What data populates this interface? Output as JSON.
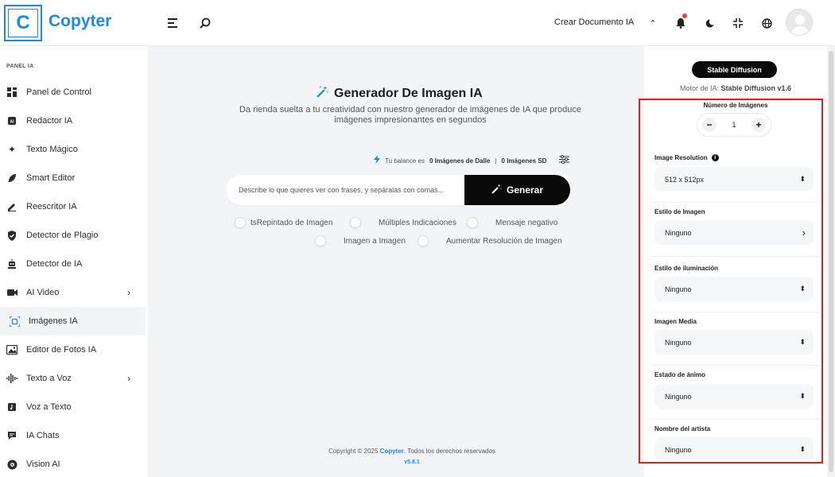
{
  "header": {
    "logo_letter": "C",
    "logo_text": "Copyter",
    "crear_documento": "Crear Documento IA"
  },
  "sidebar": {
    "section_title": "PANEL IA",
    "items": [
      {
        "label": "Panel de Control",
        "icon": "dashboard-icon"
      },
      {
        "label": "Redactor IA",
        "icon": "ai-chip-icon"
      },
      {
        "label": "Texto Mágico",
        "icon": "sparkles-icon"
      },
      {
        "label": "Smart Editor",
        "icon": "feather-icon"
      },
      {
        "label": "Reescritor IA",
        "icon": "pencil-icon"
      },
      {
        "label": "Detector de Plagio",
        "icon": "shield-icon"
      },
      {
        "label": "Detector de IA",
        "icon": "robot-icon"
      },
      {
        "label": "AI Video",
        "icon": "video-icon",
        "chevron": true
      },
      {
        "label": "Imágenes IA",
        "icon": "image-scan-icon",
        "active": true
      },
      {
        "label": "Editor de Fotos IA",
        "icon": "photo-editor-icon"
      },
      {
        "label": "Texto a Voz",
        "icon": "waveform-icon",
        "chevron": true
      },
      {
        "label": "Voz a Texto",
        "icon": "audio-file-icon"
      },
      {
        "label": "IA Chats",
        "icon": "chat-icon"
      },
      {
        "label": "Vision AI",
        "icon": "vision-icon"
      }
    ]
  },
  "main": {
    "title": "Generador De Imagen IA",
    "subtitle": "Da rienda suelta a tu creatividad con nuestro generador de imágenes de IA que produce imágenes impresionantes en segundos",
    "balance_prefix": "Tu balance es",
    "balance_dalle": "0 Imágenes de Dalle",
    "balance_sep": "|",
    "balance_sd": "0 Imágenes SD",
    "prompt_placeholder": "Describe lo que quieres ver con frases, y sepáralas con comas...",
    "generate_label": "Generar",
    "toggles": [
      "tsRepintado de Imagen",
      "Múltiples Indicaciones",
      "Mensaje negativo",
      "Imagen a Imagen",
      "Aumentar Resolución de Imagen"
    ],
    "copyright_prefix": "Copyright © 2025",
    "copyright_brand": "Copyter",
    "copyright_suffix": ". Todos los derechos reservados",
    "version": "v5.8.1"
  },
  "panel": {
    "model_badge": "Stable Diffusion",
    "motor_prefix": "Motor de IA:",
    "motor_value": "Stable Diffusion v1.6",
    "num_images_label": "Número de Imágenes",
    "num_images_value": "1",
    "fields": [
      {
        "label": "Image Resolution",
        "value": "512 x 512px",
        "indicator": "⬍",
        "info": true
      },
      {
        "label": "Estilo de Imagen",
        "value": "Ninguno",
        "indicator": "›"
      },
      {
        "label": "Estilo de iluminación",
        "value": "Ninguno",
        "indicator": "⬍"
      },
      {
        "label": "Imagen Media",
        "value": "Ninguno",
        "indicator": "⬍"
      },
      {
        "label": "Estado de ánimo",
        "value": "Ninguno",
        "indicator": "⬍"
      },
      {
        "label": "Nombre del artista",
        "value": "Ninguno",
        "indicator": "⬍"
      }
    ]
  },
  "colors": {
    "accent": "#1e88e5",
    "highlight_border": "#e02020"
  }
}
